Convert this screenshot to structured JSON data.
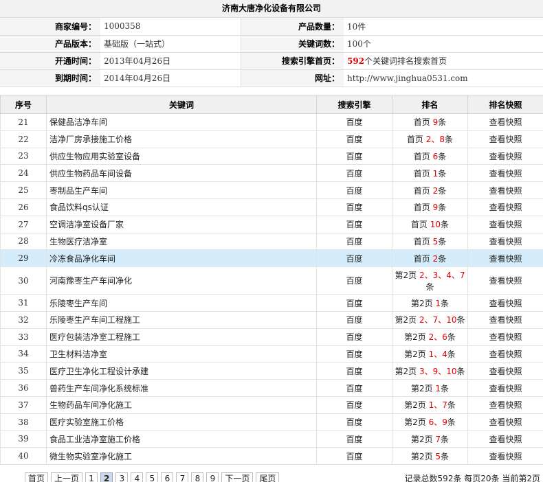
{
  "company_name": "济南大唐净化设备有限公司",
  "info": {
    "merchant_id_label": "商家编号：",
    "merchant_id": "1000358",
    "product_count_label": "产品数量：",
    "product_count": "10件",
    "version_label": "产品版本：",
    "version": "基础版（一站式）",
    "keyword_count_label": "关键词数：",
    "keyword_count": "100个",
    "open_time_label": "开通时间：",
    "open_time": "2013年04月26日",
    "engine_home_label": "搜索引擎首页：",
    "engine_home_num": "592",
    "engine_home_text": "个关键词排名搜索首页",
    "expire_label": "到期时间：",
    "expire_time": "2014年04月26日",
    "site_label": "网址：",
    "site": "http://www.jinghua0531.com"
  },
  "table": {
    "headers": [
      "序号",
      "关键词",
      "搜索引擎",
      "排名",
      "排名快照"
    ],
    "rows": [
      {
        "no": "21",
        "keyword": "保健品洁净车间",
        "engine": "百度",
        "page": "首页",
        "nums": "9",
        "unit": "条",
        "snapshot": "查看快照"
      },
      {
        "no": "22",
        "keyword": "洁净厂房承接施工价格",
        "engine": "百度",
        "page": "首页",
        "nums": "2、8",
        "unit": "条",
        "snapshot": "查看快照"
      },
      {
        "no": "23",
        "keyword": "供应生物应用实验室设备",
        "engine": "百度",
        "page": "首页",
        "nums": "6",
        "unit": "条",
        "snapshot": "查看快照"
      },
      {
        "no": "24",
        "keyword": "供应生物药品车间设备",
        "engine": "百度",
        "page": "首页",
        "nums": "1",
        "unit": "条",
        "snapshot": "查看快照"
      },
      {
        "no": "25",
        "keyword": "枣制品生产车间",
        "engine": "百度",
        "page": "首页",
        "nums": "2",
        "unit": "条",
        "snapshot": "查看快照"
      },
      {
        "no": "26",
        "keyword": "食品饮料qs认证",
        "engine": "百度",
        "page": "首页",
        "nums": "9",
        "unit": "条",
        "snapshot": "查看快照"
      },
      {
        "no": "27",
        "keyword": "空调洁净室设备厂家",
        "engine": "百度",
        "page": "首页",
        "nums": "10",
        "unit": "条",
        "snapshot": "查看快照"
      },
      {
        "no": "28",
        "keyword": "生物医疗洁净室",
        "engine": "百度",
        "page": "首页",
        "nums": "5",
        "unit": "条",
        "snapshot": "查看快照"
      },
      {
        "no": "29",
        "keyword": "冷冻食品净化车间",
        "engine": "百度",
        "page": "首页",
        "nums": "2",
        "unit": "条",
        "snapshot": "查看快照"
      },
      {
        "no": "30",
        "keyword": "河南豫枣生产车间净化",
        "engine": "百度",
        "page": "第2页",
        "nums": "2、3、4、7",
        "unit": "条",
        "snapshot": "查看快照"
      },
      {
        "no": "31",
        "keyword": "乐陵枣生产车间",
        "engine": "百度",
        "page": "第2页",
        "nums": "1",
        "unit": "条",
        "snapshot": "查看快照"
      },
      {
        "no": "32",
        "keyword": "乐陵枣生产车间工程施工",
        "engine": "百度",
        "page": "第2页",
        "nums": "2、7、10",
        "unit": "条",
        "snapshot": "查看快照"
      },
      {
        "no": "33",
        "keyword": "医疗包装洁净室工程施工",
        "engine": "百度",
        "page": "第2页",
        "nums": "2、6",
        "unit": "条",
        "snapshot": "查看快照"
      },
      {
        "no": "34",
        "keyword": "卫生材料洁净室",
        "engine": "百度",
        "page": "第2页",
        "nums": "1、4",
        "unit": "条",
        "snapshot": "查看快照"
      },
      {
        "no": "35",
        "keyword": "医疗卫生净化工程设计承建",
        "engine": "百度",
        "page": "第2页",
        "nums": "3、9、10",
        "unit": "条",
        "snapshot": "查看快照"
      },
      {
        "no": "36",
        "keyword": "兽药生产车间净化系统标准",
        "engine": "百度",
        "page": "第2页",
        "nums": "1",
        "unit": "条",
        "snapshot": "查看快照"
      },
      {
        "no": "37",
        "keyword": "生物药品车间净化施工",
        "engine": "百度",
        "page": "第2页",
        "nums": "1、7",
        "unit": "条",
        "snapshot": "查看快照"
      },
      {
        "no": "38",
        "keyword": "医疗实验室施工价格",
        "engine": "百度",
        "page": "第2页",
        "nums": "6、9",
        "unit": "条",
        "snapshot": "查看快照"
      },
      {
        "no": "39",
        "keyword": "食品工业洁净室施工价格",
        "engine": "百度",
        "page": "第2页",
        "nums": "7",
        "unit": "条",
        "snapshot": "查看快照"
      },
      {
        "no": "40",
        "keyword": "微生物实验室净化施工",
        "engine": "百度",
        "page": "第2页",
        "nums": "5",
        "unit": "条",
        "snapshot": "查看快照"
      }
    ]
  },
  "pager": {
    "first": "首页",
    "prev": "上一页",
    "pages": [
      "1",
      "2",
      "3",
      "4",
      "5",
      "6",
      "7",
      "8",
      "9"
    ],
    "current": "2",
    "next": "下一页",
    "last": "尾页",
    "summary": "记录总数592条 每页20条 当前第2页"
  },
  "colors": {
    "highlight_row": "#d5ecfb",
    "rank_number": "#e00000"
  }
}
